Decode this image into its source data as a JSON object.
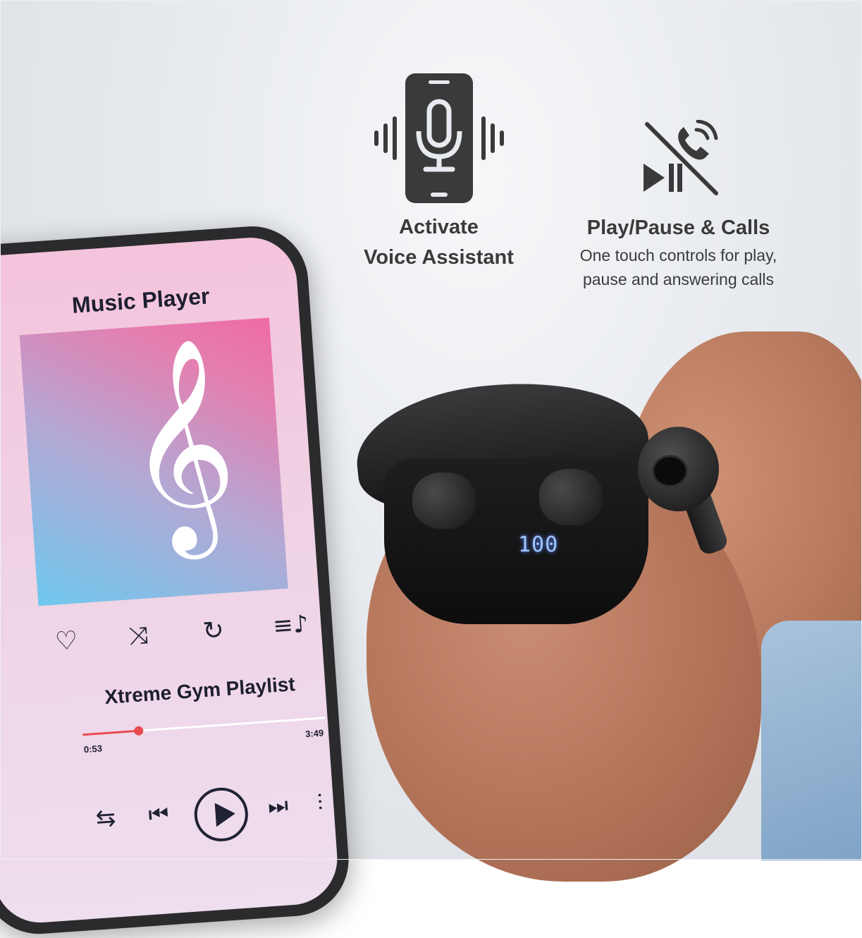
{
  "features": {
    "voice": {
      "title_line1": "Activate",
      "title_line2": "Voice Assistant",
      "icon": "voice-assistant-phone-icon"
    },
    "play": {
      "title": "Play/Pause & Calls",
      "sub_line1": "One touch controls for play,",
      "sub_line2": "pause and answering calls",
      "icon": "play-pause-calls-icon"
    }
  },
  "player": {
    "title": "Music Player",
    "song_title": "Xtreme Gym Playlist",
    "elapsed": "0:53",
    "duration": "3:49",
    "progress": 0.23,
    "controls_top": [
      "heart-icon",
      "shuffle-icon",
      "repeat-one-icon",
      "playlist-icon"
    ],
    "controls_bottom": [
      "repeat-icon",
      "previous-icon",
      "play-icon",
      "next-icon",
      "equalizer-icon"
    ]
  },
  "case": {
    "battery_display": "100"
  },
  "colors": {
    "accent": "#e94a4f",
    "text_dark": "#1d1f2f",
    "icon_dark": "#3a3a3a"
  }
}
